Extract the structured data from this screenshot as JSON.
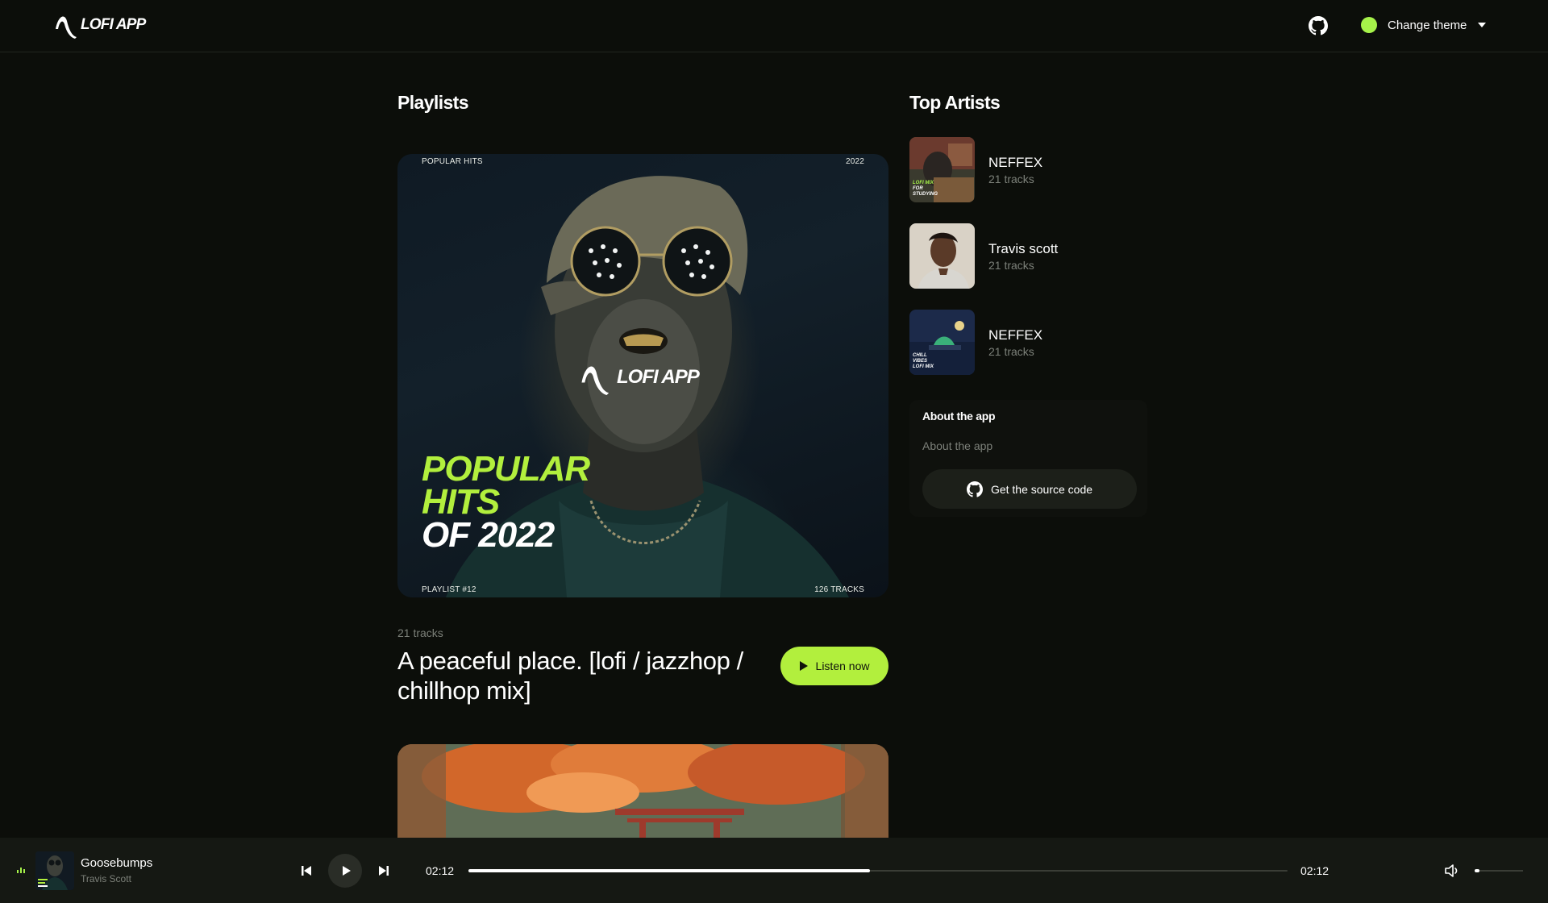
{
  "app": {
    "logo_text": "LOFI APP"
  },
  "header": {
    "github_icon": "github-icon",
    "theme_label": "Change theme",
    "theme_color": "#a6f24a"
  },
  "playlists": {
    "title": "Playlists",
    "items": [
      {
        "cover": {
          "top_left": "POPULAR HITS",
          "top_right": "2022",
          "logo_text": "LOFI APP",
          "title_line1": "POPULAR",
          "title_line2": "HITS",
          "title_line3": "OF 2022",
          "bottom_left": "PLAYLIST #12",
          "bottom_right": "126 TRACKS"
        },
        "tracks": "21 tracks",
        "name": "A peaceful place. [lofi / jazzhop / chillhop mix]",
        "listen_label": "Listen now"
      }
    ]
  },
  "top_artists": {
    "title": "Top Artists",
    "items": [
      {
        "name": "NEFFEX",
        "tracks": "21 tracks",
        "thumb_text": "LOFI MIX FOR STUDYING"
      },
      {
        "name": "Travis scott",
        "tracks": "21 tracks"
      },
      {
        "name": "NEFFEX",
        "tracks": "21 tracks",
        "thumb_text": "CHILL VIBES LOFI MIX"
      }
    ]
  },
  "about": {
    "title": "About the app",
    "text": "About the app",
    "source_button": "Get the source code"
  },
  "player": {
    "title": "Goosebumps",
    "artist": "Travis Scott",
    "current_time": "02:12",
    "duration": "02:12",
    "progress": 0.49,
    "volume": 0.1,
    "accent": "#b2ef3d"
  }
}
